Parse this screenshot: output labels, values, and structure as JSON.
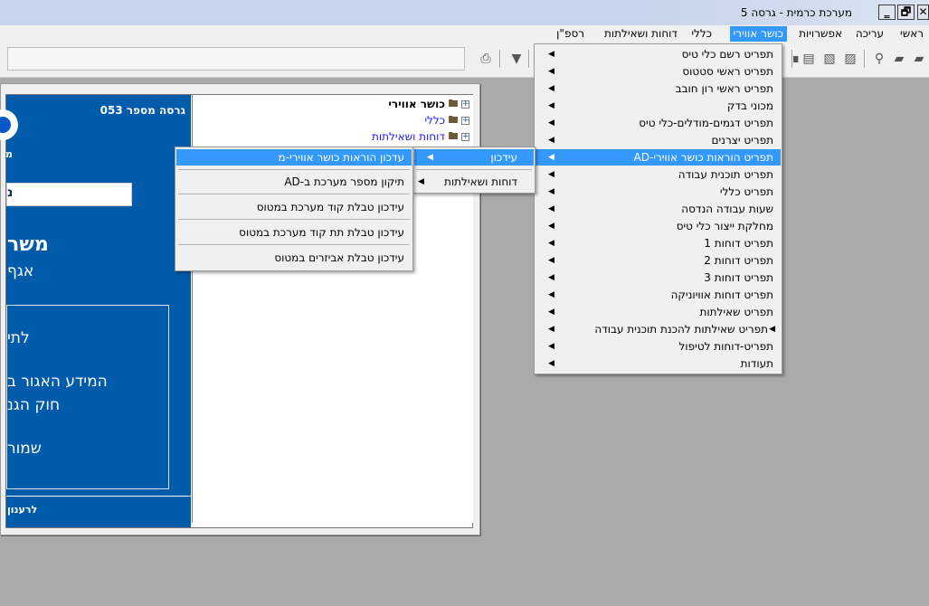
{
  "window": {
    "title": "מערכת כרמית - גרסה 5",
    "buttons": [
      "✕",
      "🗗",
      "‗"
    ]
  },
  "menubar": {
    "items": [
      "ראשי",
      "עריכה",
      "אפשרויות",
      "כושר אווירי",
      "כללי",
      "דוחות ושאילתות",
      "רספ\"ן"
    ]
  },
  "main_menu": {
    "items": [
      "תפריט רשם כלי טיס",
      "תפריט ראשי סטטוס",
      "תפריט ראשי רון חובב",
      "מכוני בדק",
      "תפריט דגמים-מודלים-כלי טיס",
      "תפריט יצרנים",
      "תפריט הוראות כושר אווירי-AD",
      "תפריט תוכנית עבודה",
      "תפריט כללי",
      "שעות עבודה הנדסה",
      "מחלקת ייצור כלי טיס",
      "תפריט דוחות 1",
      "תפריט דוחות 2",
      "תפריט דוחות 3",
      "תפריט דוחות אוויוניקה",
      "תפריט שאילתות",
      "תפריט שאילתות להכנת תוכנית עבודה",
      "תפריט-דוחות לטיפול",
      "תעודות"
    ],
    "highlighted_index": 6
  },
  "sub_menu_1": {
    "items": [
      "עידכון",
      "דוחות ושאילתות"
    ],
    "highlighted_index": 0
  },
  "sub_menu_2": {
    "items": [
      "עדכון הוראות כושר אווירי-מ",
      "תיקון מספר מערכת ב-AD",
      "עידכון טבלת קוד מערכת במטוס",
      "עידכון טבלת תת קוד מערכת במטוס",
      "עידכון טבלת אביזרים במטוס"
    ],
    "highlighted_index": 0
  },
  "tree": {
    "items": [
      "כושר אווירי",
      "כללי",
      "דוחות ושאילתות"
    ]
  },
  "splash": {
    "version": "גרסה מספר 053",
    "logo_text": "מ",
    "org_box": "נ",
    "ministry_title": "משר",
    "ministry_sub": "אגף",
    "notice_1": "לתי",
    "notice_2": "המידע האגור ב",
    "notice_3": "חוק הגנ",
    "notice_4": "שמור",
    "footer": "לרענון"
  },
  "colors": {
    "accent": "#3399ff",
    "panel_blue": "#005baa",
    "desktop": "#aaaaaa"
  }
}
